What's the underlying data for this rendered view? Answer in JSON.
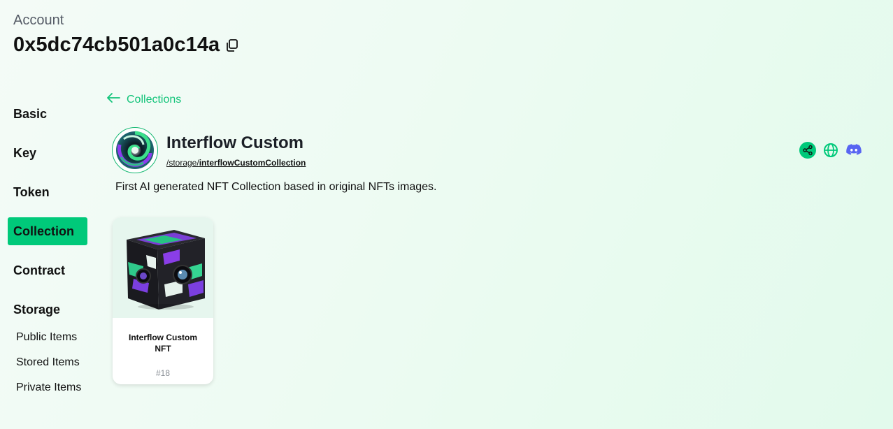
{
  "account": {
    "label": "Account",
    "address": "0x5dc74cb501a0c14a"
  },
  "sidebar": {
    "items": [
      {
        "label": "Basic"
      },
      {
        "label": "Key"
      },
      {
        "label": "Token"
      },
      {
        "label": "Collection",
        "active": true
      },
      {
        "label": "Contract"
      },
      {
        "label": "Storage"
      }
    ],
    "storage_subitems": [
      {
        "label": "Public Items"
      },
      {
        "label": "Stored Items"
      },
      {
        "label": "Private Items"
      }
    ]
  },
  "back_link": {
    "label": "Collections"
  },
  "collection": {
    "title": "Interflow Custom",
    "path_prefix": "/storage/",
    "path_name": "interflowCustomCollection",
    "description": "First AI generated NFT Collection based in original NFTs images.",
    "social_icons": [
      "share-icon",
      "globe-icon",
      "discord-icon"
    ]
  },
  "nfts": [
    {
      "name": "Interflow Custom NFT",
      "id": "#18"
    }
  ],
  "colors": {
    "accent": "#00c97a",
    "link": "#13c47a",
    "discord": "#5865f2"
  }
}
